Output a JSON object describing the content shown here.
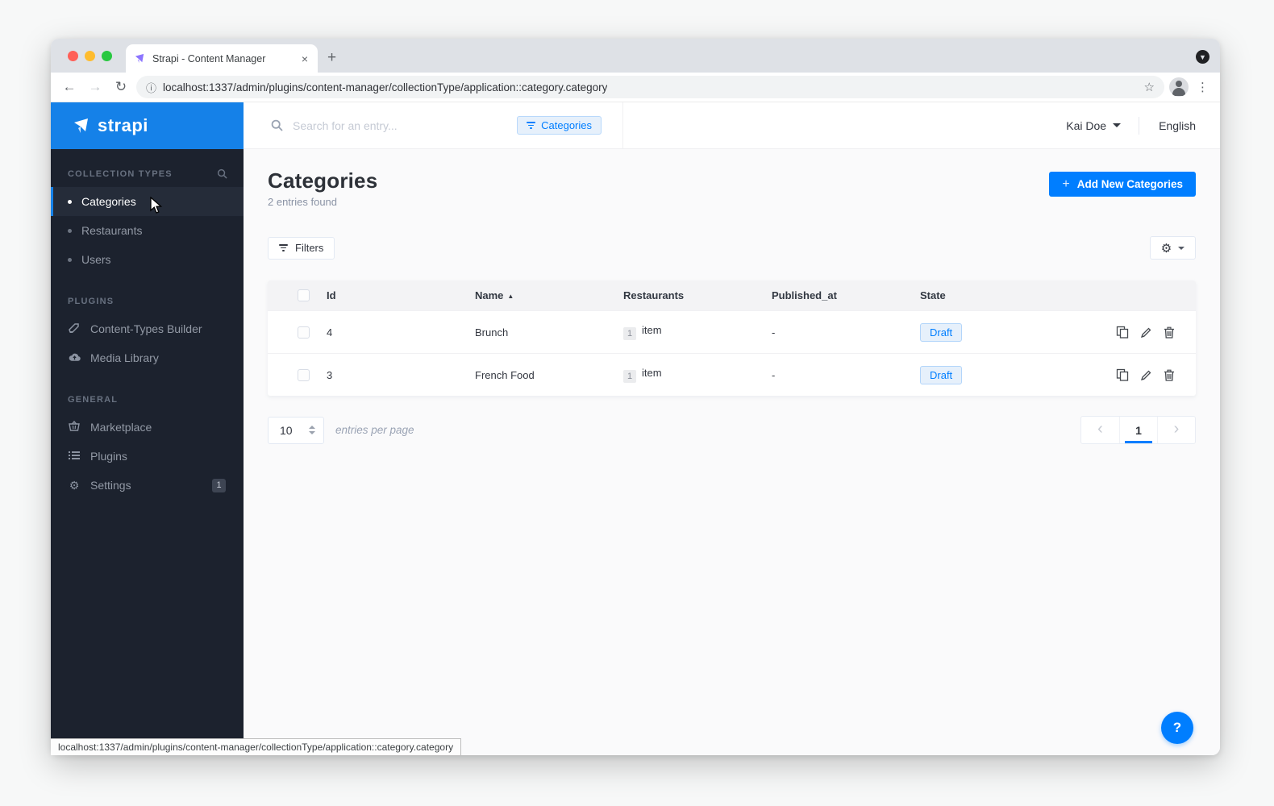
{
  "browser": {
    "tab_title": "Strapi - Content Manager",
    "close_tab": "×",
    "new_tab": "+",
    "back": "←",
    "forward": "→",
    "reload": "↻",
    "url": "localhost:1337/admin/plugins/content-manager/collectionType/application::category.category",
    "status_url": "localhost:1337/admin/plugins/content-manager/collectionType/application::category.category",
    "menu_dots": "⋮",
    "star": "☆",
    "info": "ⓘ",
    "tab_search_caret": "▼"
  },
  "sidebar": {
    "logo_text": "strapi",
    "sections": {
      "collection_types": {
        "label": "COLLECTION TYPES",
        "items": [
          {
            "label": "Categories"
          },
          {
            "label": "Restaurants"
          },
          {
            "label": "Users"
          }
        ]
      },
      "plugins": {
        "label": "PLUGINS",
        "items": [
          {
            "label": "Content-Types Builder"
          },
          {
            "label": "Media Library"
          }
        ]
      },
      "general": {
        "label": "GENERAL",
        "items": [
          {
            "label": "Marketplace"
          },
          {
            "label": "Plugins"
          },
          {
            "label": "Settings",
            "badge": "1"
          }
        ]
      }
    }
  },
  "header": {
    "search_placeholder": "Search for an entry...",
    "filter_chip": "Categories",
    "user_name": "Kai Doe",
    "language": "English"
  },
  "main": {
    "title": "Categories",
    "entries_found": "2 entries found",
    "add_button_label": "Add New Categories",
    "add_button_plus": "+",
    "filters_label": "Filters",
    "table": {
      "columns": {
        "id": "Id",
        "name": "Name",
        "restaurants": "Restaurants",
        "published_at": "Published_at",
        "state": "State"
      },
      "sort_indicator": "▲",
      "rows": [
        {
          "id": "4",
          "name": "Brunch",
          "restaurants_count": "1",
          "restaurants_unit": "item",
          "published_at": "-",
          "state": "Draft"
        },
        {
          "id": "3",
          "name": "French Food",
          "restaurants_count": "1",
          "restaurants_unit": "item",
          "published_at": "-",
          "state": "Draft"
        }
      ]
    },
    "pagination": {
      "per_page": "10",
      "per_page_label": "entries per page",
      "prev": "‹",
      "next": "›",
      "current_page": "1"
    }
  },
  "help": {
    "label": "?"
  },
  "colors": {
    "accent": "#007eff",
    "logo_header": "#1581e8",
    "sidebar_bg": "#1c222e",
    "draft_badge_bg": "#e6f0fb",
    "draft_badge_text": "#007eff"
  }
}
